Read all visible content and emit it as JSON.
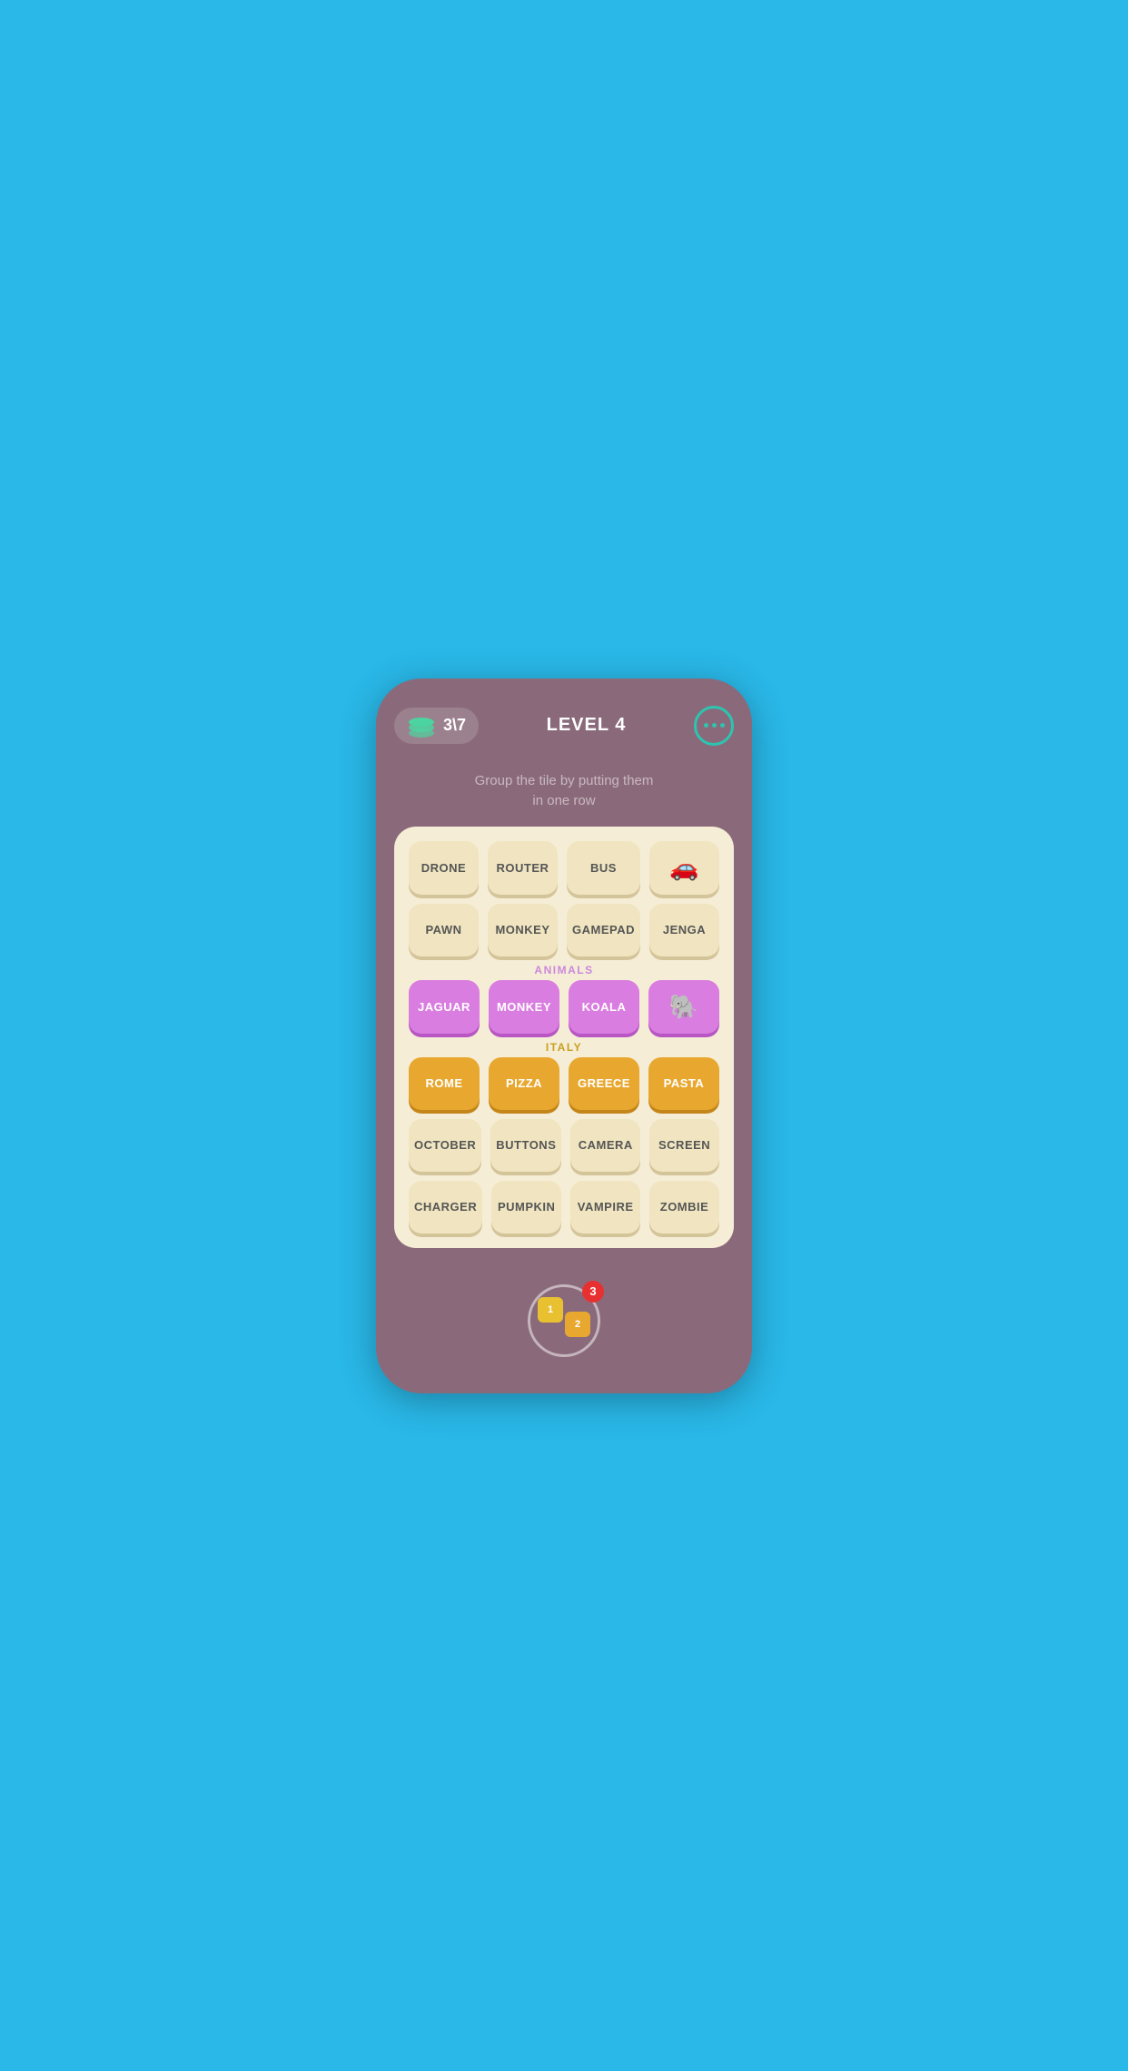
{
  "header": {
    "score": "3\\7",
    "level": "LEVEL 4",
    "menu_label": "menu"
  },
  "instruction": "Group the tile by putting them\nin one row",
  "board": {
    "regular_tiles": [
      {
        "id": "drone",
        "label": "DRONE",
        "type": "text"
      },
      {
        "id": "router",
        "label": "ROUTER",
        "type": "text"
      },
      {
        "id": "bus",
        "label": "BUS",
        "type": "text"
      },
      {
        "id": "car",
        "label": "🚗",
        "type": "icon"
      },
      {
        "id": "pawn",
        "label": "PAWN",
        "type": "text"
      },
      {
        "id": "monkey2",
        "label": "MONKEY",
        "type": "text"
      },
      {
        "id": "gamepad",
        "label": "GAMEPAD",
        "type": "text"
      },
      {
        "id": "jenga",
        "label": "JENGA",
        "type": "text"
      }
    ],
    "animals_group": {
      "label": "ANIMALS",
      "tiles": [
        {
          "id": "jaguar",
          "label": "JAGUAR",
          "type": "text"
        },
        {
          "id": "monkey",
          "label": "MONKEY",
          "type": "text"
        },
        {
          "id": "koala",
          "label": "KOALA",
          "type": "text"
        },
        {
          "id": "elephant",
          "label": "🐘",
          "type": "icon"
        }
      ]
    },
    "italy_group": {
      "label": "ITALY",
      "tiles": [
        {
          "id": "rome",
          "label": "ROME",
          "type": "text"
        },
        {
          "id": "pizza",
          "label": "PIZZA",
          "type": "text"
        },
        {
          "id": "greece",
          "label": "GREECE",
          "type": "text"
        },
        {
          "id": "pasta",
          "label": "PASTA",
          "type": "text"
        }
      ]
    },
    "bottom_tiles_row1": [
      {
        "id": "october",
        "label": "OCTOBER",
        "type": "text"
      },
      {
        "id": "buttons",
        "label": "BUTTONS",
        "type": "text"
      },
      {
        "id": "camera",
        "label": "CAMERA",
        "type": "text"
      },
      {
        "id": "screen",
        "label": "SCREEN",
        "type": "text"
      }
    ],
    "bottom_tiles_row2": [
      {
        "id": "charger",
        "label": "CHARGER",
        "type": "text"
      },
      {
        "id": "pumpkin",
        "label": "PUMPKIN",
        "type": "text"
      },
      {
        "id": "vampire",
        "label": "VAMPIRE",
        "type": "text"
      },
      {
        "id": "zombie",
        "label": "ZOMBIE",
        "type": "text"
      }
    ]
  },
  "hint": {
    "tile1_label": "1",
    "tile2_label": "2",
    "badge_count": "3"
  }
}
